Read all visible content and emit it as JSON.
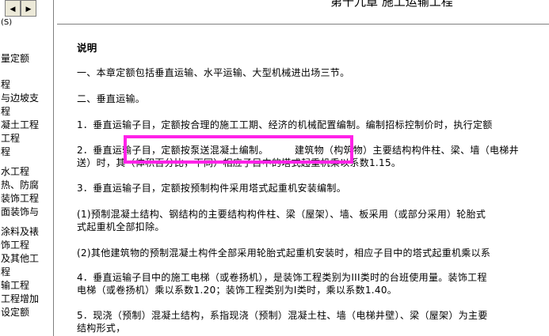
{
  "nav": {
    "back_glyph": "◀",
    "forward_glyph": "▶",
    "tab_label": "(S)",
    "items": [
      "量定额",
      "程",
      "与边坡支",
      "程",
      "凝土工程",
      "工程",
      "程",
      "水工程",
      "热、防腐",
      "装饰工程",
      "面装饰与",
      "涂料及裱",
      "饰工程",
      "及其他工",
      "程",
      "输工程",
      "工程增加",
      "设定额"
    ]
  },
  "document": {
    "chapter_title": "第十九章  施工运输工程",
    "heading": "说明",
    "lines": [
      "一、本章定额包括垂直运输、水平运输、大型机械进出场三节。",
      "二、垂直运输。",
      "1．垂直运输子目，定额按合理的施工工期、经济的机械配置编制。编制招标控制价时，执行定额",
      "2．垂直运输子目，定额按泵送混凝土编制。",
      "建筑物（构筑物）主要结构构件柱、梁、墙（电梯井",
      "送）时，其（体积百分比，下同）相应子目中的塔式起重机乘以系数1.15。",
      "3．垂直运输子目，定额按预制构件采用塔式起重机安装编制。",
      "(1)预制混凝土结构、钢结构的主要结构构件柱、梁（屋架）、墙、板采用（或部分采用）轮胎式",
      "式起重机全部扣除。",
      "(2)其他建筑物的预制混凝土构件全部采用轮胎式起重机安装时，相应子目中的塔式起重机乘以系",
      "4．垂直运输子目中的施工电梯（或卷扬机），是装饰工程类别为III类时的台班使用量。装饰工程",
      "电梯（或卷扬机）乘以系数1.20；装饰工程类别为I类时，乘以系数1.40。",
      "5．现浇（预制）混凝土结构，系指现浇（预制）混凝土柱、墙（电梯井壁）、梁（屋架）为主要",
      "结构形式，"
    ]
  },
  "highlight_color": "#ff22e8"
}
